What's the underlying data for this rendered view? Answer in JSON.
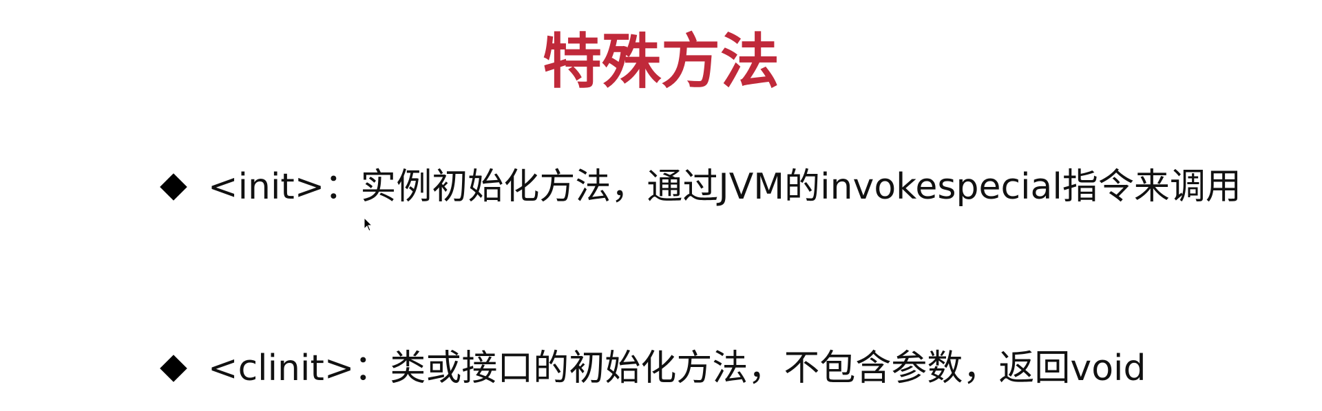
{
  "slide": {
    "title": "特殊方法",
    "bullets": [
      {
        "text": "<init>：实例初始化方法，通过JVM的invokespecial指令来调用"
      },
      {
        "text": "<clinit>：类或接口的初始化方法，不包含参数，返回void"
      }
    ]
  },
  "icons": {
    "bullet": "diamond-bullet-icon",
    "pointer": "mouse-cursor-icon"
  },
  "colors": {
    "title": "#c0293a",
    "text": "#111111",
    "background": "#ffffff"
  }
}
